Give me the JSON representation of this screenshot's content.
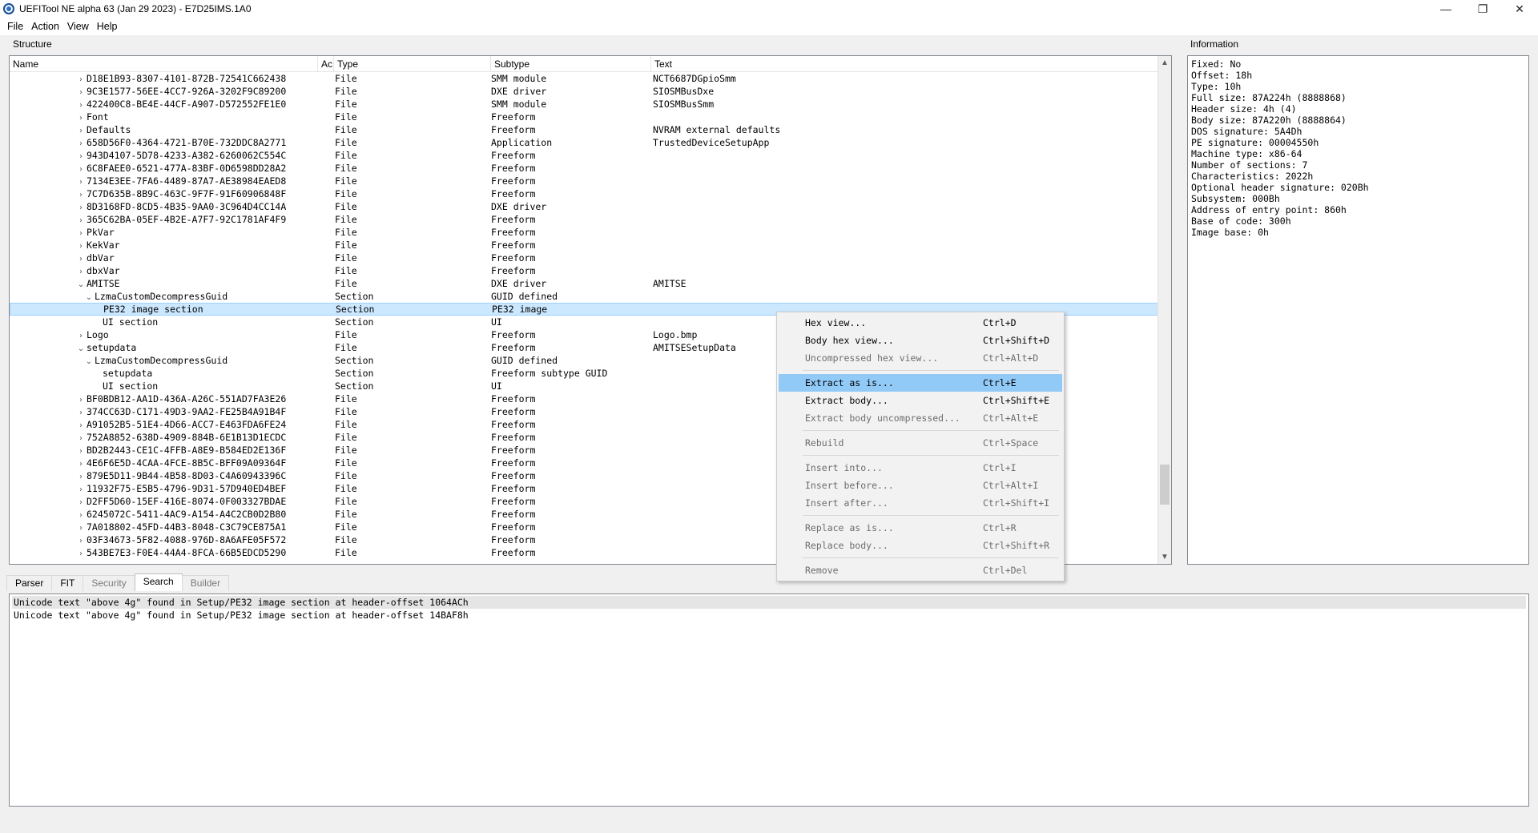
{
  "window": {
    "title": "UEFITool NE alpha 63 (Jan 29 2023) - E7D25IMS.1A0",
    "minimize": "—",
    "restore": "❐",
    "close": "✕"
  },
  "menu": [
    "File",
    "Action",
    "View",
    "Help"
  ],
  "structure": {
    "label": "Structure",
    "columns": [
      "Name",
      "Ac",
      "Type",
      "Subtype",
      "Text"
    ],
    "rows": [
      {
        "arrow": "›",
        "indent": 2,
        "name": "D18E1B93-8307-4101-872B-72541C662438",
        "type": "File",
        "subtype": "SMM module",
        "text": "NCT6687DGpioSmm"
      },
      {
        "arrow": "›",
        "indent": 2,
        "name": "9C3E1577-56EE-4CC7-926A-3202F9C89200",
        "type": "File",
        "subtype": "DXE driver",
        "text": "SIOSMBusDxe"
      },
      {
        "arrow": "›",
        "indent": 2,
        "name": "422400C8-BE4E-44CF-A907-D572552FE1E0",
        "type": "File",
        "subtype": "SMM module",
        "text": "SIOSMBusSmm"
      },
      {
        "arrow": "›",
        "indent": 2,
        "name": "Font",
        "type": "File",
        "subtype": "Freeform",
        "text": ""
      },
      {
        "arrow": "›",
        "indent": 2,
        "name": "Defaults",
        "type": "File",
        "subtype": "Freeform",
        "text": "NVRAM external defaults"
      },
      {
        "arrow": "›",
        "indent": 2,
        "name": "658D56F0-4364-4721-B70E-732DDC8A2771",
        "type": "File",
        "subtype": "Application",
        "text": "TrustedDeviceSetupApp"
      },
      {
        "arrow": "›",
        "indent": 2,
        "name": "943D4107-5D78-4233-A382-6260062C554C",
        "type": "File",
        "subtype": "Freeform",
        "text": ""
      },
      {
        "arrow": "›",
        "indent": 2,
        "name": "6C8FAEE0-6521-477A-83BF-0D6598DD28A2",
        "type": "File",
        "subtype": "Freeform",
        "text": ""
      },
      {
        "arrow": "›",
        "indent": 2,
        "name": "7134E3EE-7FA6-4489-87A7-AE38984EAED8",
        "type": "File",
        "subtype": "Freeform",
        "text": ""
      },
      {
        "arrow": "›",
        "indent": 2,
        "name": "7C7D635B-8B9C-463C-9F7F-91F60906848F",
        "type": "File",
        "subtype": "Freeform",
        "text": ""
      },
      {
        "arrow": "›",
        "indent": 2,
        "name": "8D3168FD-8CD5-4B35-9AA0-3C964D4CC14A",
        "type": "File",
        "subtype": "DXE driver",
        "text": ""
      },
      {
        "arrow": "›",
        "indent": 2,
        "name": "365C62BA-05EF-4B2E-A7F7-92C1781AF4F9",
        "type": "File",
        "subtype": "Freeform",
        "text": ""
      },
      {
        "arrow": "›",
        "indent": 2,
        "name": "PkVar",
        "type": "File",
        "subtype": "Freeform",
        "text": ""
      },
      {
        "arrow": "›",
        "indent": 2,
        "name": "KekVar",
        "type": "File",
        "subtype": "Freeform",
        "text": ""
      },
      {
        "arrow": "›",
        "indent": 2,
        "name": "dbVar",
        "type": "File",
        "subtype": "Freeform",
        "text": ""
      },
      {
        "arrow": "›",
        "indent": 2,
        "name": "dbxVar",
        "type": "File",
        "subtype": "Freeform",
        "text": ""
      },
      {
        "arrow": "⌄",
        "indent": 2,
        "name": "AMITSE",
        "type": "File",
        "subtype": "DXE driver",
        "text": "AMITSE"
      },
      {
        "arrow": "⌄",
        "indent": 3,
        "name": "LzmaCustomDecompressGuid",
        "type": "Section",
        "subtype": "GUID defined",
        "text": ""
      },
      {
        "arrow": "",
        "indent": 4,
        "name": "PE32 image section",
        "type": "Section",
        "subtype": "PE32 image",
        "text": "",
        "selected": true
      },
      {
        "arrow": "",
        "indent": 4,
        "name": "UI section",
        "type": "Section",
        "subtype": "UI",
        "text": ""
      },
      {
        "arrow": "›",
        "indent": 2,
        "name": "Logo",
        "type": "File",
        "subtype": "Freeform",
        "text": "Logo.bmp"
      },
      {
        "arrow": "⌄",
        "indent": 2,
        "name": "setupdata",
        "type": "File",
        "subtype": "Freeform",
        "text": "AMITSESetupData"
      },
      {
        "arrow": "⌄",
        "indent": 3,
        "name": "LzmaCustomDecompressGuid",
        "type": "Section",
        "subtype": "GUID defined",
        "text": ""
      },
      {
        "arrow": "",
        "indent": 4,
        "name": "setupdata",
        "type": "Section",
        "subtype": "Freeform subtype GUID",
        "text": ""
      },
      {
        "arrow": "",
        "indent": 4,
        "name": "UI section",
        "type": "Section",
        "subtype": "UI",
        "text": ""
      },
      {
        "arrow": "›",
        "indent": 2,
        "name": "BF0BDB12-AA1D-436A-A26C-551AD7FA3E26",
        "type": "File",
        "subtype": "Freeform",
        "text": ""
      },
      {
        "arrow": "›",
        "indent": 2,
        "name": "374CC63D-C171-49D3-9AA2-FE25B4A91B4F",
        "type": "File",
        "subtype": "Freeform",
        "text": ""
      },
      {
        "arrow": "›",
        "indent": 2,
        "name": "A91052B5-51E4-4D66-ACC7-E463FDA6FE24",
        "type": "File",
        "subtype": "Freeform",
        "text": ""
      },
      {
        "arrow": "›",
        "indent": 2,
        "name": "752A8852-638D-4909-884B-6E1B13D1ECDC",
        "type": "File",
        "subtype": "Freeform",
        "text": ""
      },
      {
        "arrow": "›",
        "indent": 2,
        "name": "BD2B2443-CE1C-4FFB-A8E9-B584ED2E136F",
        "type": "File",
        "subtype": "Freeform",
        "text": ""
      },
      {
        "arrow": "›",
        "indent": 2,
        "name": "4E6F6E5D-4CAA-4FCE-8B5C-BFF09A09364F",
        "type": "File",
        "subtype": "Freeform",
        "text": ""
      },
      {
        "arrow": "›",
        "indent": 2,
        "name": "879E5D11-9B44-4B58-8D03-C4A60943396C",
        "type": "File",
        "subtype": "Freeform",
        "text": ""
      },
      {
        "arrow": "›",
        "indent": 2,
        "name": "11932F75-E5B5-4796-9D31-57D940ED4BEF",
        "type": "File",
        "subtype": "Freeform",
        "text": ""
      },
      {
        "arrow": "›",
        "indent": 2,
        "name": "D2FF5D60-15EF-416E-8074-0F003327BDAE",
        "type": "File",
        "subtype": "Freeform",
        "text": ""
      },
      {
        "arrow": "›",
        "indent": 2,
        "name": "6245072C-5411-4AC9-A154-A4C2CB0D2B80",
        "type": "File",
        "subtype": "Freeform",
        "text": ""
      },
      {
        "arrow": "›",
        "indent": 2,
        "name": "7A018802-45FD-44B3-8048-C3C79CE875A1",
        "type": "File",
        "subtype": "Freeform",
        "text": ""
      },
      {
        "arrow": "›",
        "indent": 2,
        "name": "03F34673-5F82-4088-976D-8A6AFE05F572",
        "type": "File",
        "subtype": "Freeform",
        "text": ""
      },
      {
        "arrow": "›",
        "indent": 2,
        "name": "543BE7E3-F0E4-44A4-8FCA-66B5EDCD5290",
        "type": "File",
        "subtype": "Freeform",
        "text": ""
      }
    ],
    "scroll_up": "▲",
    "scroll_down": "▼"
  },
  "information": {
    "label": "Information",
    "lines": [
      "Fixed: No",
      "Offset: 18h",
      "Type: 10h",
      "Full size: 87A224h (8888868)",
      "Header size: 4h (4)",
      "Body size: 87A220h (8888864)",
      "DOS signature: 5A4Dh",
      "PE signature: 00004550h",
      "Machine type: x86-64",
      "Number of sections: 7",
      "Characteristics: 2022h",
      "Optional header signature: 020Bh",
      "Subsystem: 000Bh",
      "Address of entry point: 860h",
      "Base of code: 300h",
      "Image base: 0h"
    ]
  },
  "bottom_tabs": [
    {
      "label": "Parser",
      "state": "normal"
    },
    {
      "label": "FIT",
      "state": "normal"
    },
    {
      "label": "Security",
      "state": "disabled"
    },
    {
      "label": "Search",
      "state": "active"
    },
    {
      "label": "Builder",
      "state": "disabled"
    }
  ],
  "search_results": [
    "Unicode text \"above 4g\" found in Setup/PE32 image section at header-offset 1064ACh",
    "Unicode text \"above 4g\" found in Setup/PE32 image section at header-offset 14BAF8h"
  ],
  "context_menu": [
    {
      "label": "Hex view...",
      "shortcut": "Ctrl+D",
      "state": "normal"
    },
    {
      "label": "Body hex view...",
      "shortcut": "Ctrl+Shift+D",
      "state": "normal"
    },
    {
      "label": "Uncompressed hex view...",
      "shortcut": "Ctrl+Alt+D",
      "state": "disabled"
    },
    {
      "sep": true
    },
    {
      "label": "Extract as is...",
      "shortcut": "Ctrl+E",
      "state": "hover"
    },
    {
      "label": "Extract body...",
      "shortcut": "Ctrl+Shift+E",
      "state": "normal"
    },
    {
      "label": "Extract body uncompressed...",
      "shortcut": "Ctrl+Alt+E",
      "state": "disabled"
    },
    {
      "sep": true
    },
    {
      "label": "Rebuild",
      "shortcut": "Ctrl+Space",
      "state": "disabled"
    },
    {
      "sep": true
    },
    {
      "label": "Insert into...",
      "shortcut": "Ctrl+I",
      "state": "disabled"
    },
    {
      "label": "Insert before...",
      "shortcut": "Ctrl+Alt+I",
      "state": "disabled"
    },
    {
      "label": "Insert after...",
      "shortcut": "Ctrl+Shift+I",
      "state": "disabled"
    },
    {
      "sep": true
    },
    {
      "label": "Replace as is...",
      "shortcut": "Ctrl+R",
      "state": "disabled"
    },
    {
      "label": "Replace body...",
      "shortcut": "Ctrl+Shift+R",
      "state": "disabled"
    },
    {
      "sep": true
    },
    {
      "label": "Remove",
      "shortcut": "Ctrl+Del",
      "state": "disabled"
    }
  ]
}
